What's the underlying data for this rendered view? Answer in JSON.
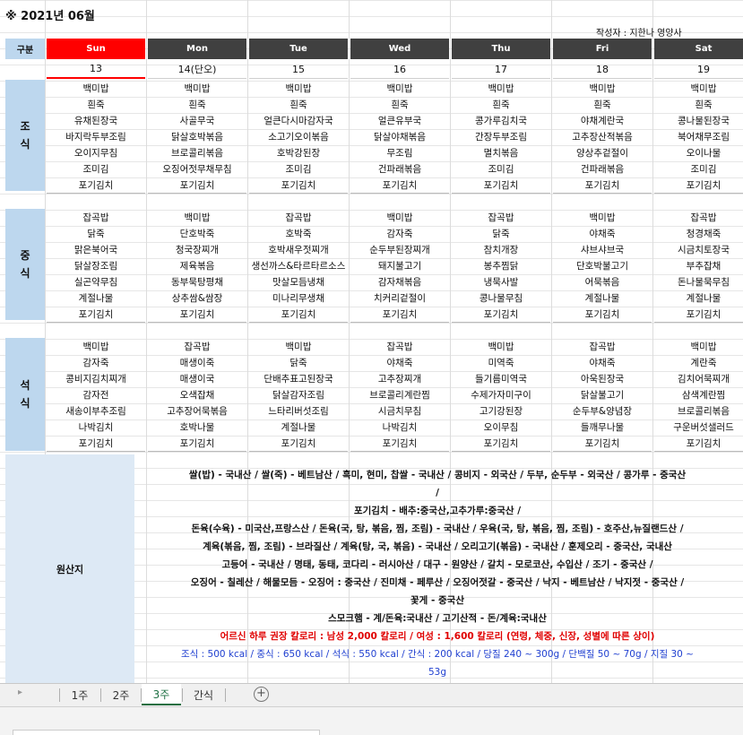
{
  "title": "※ 2021년 06월",
  "author": "작성자 : 지한나 영양사",
  "header": {
    "gubun": "구분",
    "days": [
      "Sun",
      "Mon",
      "Tue",
      "Wed",
      "Thu",
      "Fri",
      "Sat"
    ],
    "dates": [
      "13",
      "14(단오)",
      "15",
      "16",
      "17",
      "18",
      "19"
    ]
  },
  "sections": {
    "breakfast": "조식",
    "lunch": "중식",
    "dinner": "석식",
    "origin": "원산지"
  },
  "menus": {
    "breakfast": [
      [
        "백미밥",
        "흰죽",
        "유채된장국",
        "바지락두부조림",
        "오이지무침",
        "조미김",
        "포기김치"
      ],
      [
        "백미밥",
        "흰죽",
        "사골무국",
        "닭살호박볶음",
        "브로콜리볶음",
        "오징어젓무채무침",
        "포기김치"
      ],
      [
        "백미밥",
        "흰죽",
        "얼큰다시마감자국",
        "소고기오이볶음",
        "호박강된장",
        "조미김",
        "포기김치"
      ],
      [
        "백미밥",
        "흰죽",
        "얼큰유부국",
        "닭살야채볶음",
        "무조림",
        "건파래볶음",
        "포기김치"
      ],
      [
        "백미밥",
        "흰죽",
        "콩가루김치국",
        "간장두부조림",
        "멸치볶음",
        "조미김",
        "포기김치"
      ],
      [
        "백미밥",
        "흰죽",
        "야채계란국",
        "고추장산적볶음",
        "양상추겉절이",
        "건파래볶음",
        "포기김치"
      ],
      [
        "백미밥",
        "흰죽",
        "콩나물된장국",
        "북어채무조림",
        "오이나물",
        "조미김",
        "포기김치"
      ]
    ],
    "lunch": [
      [
        "잡곡밥",
        "닭죽",
        "맑은북어국",
        "닭살장조림",
        "실곤약무침",
        "계절나물",
        "포기김치"
      ],
      [
        "백미밥",
        "단호박죽",
        "청국장찌개",
        "제육볶음",
        "동부묵탕평채",
        "상추쌈&쌈장",
        "포기김치"
      ],
      [
        "잡곡밥",
        "호박죽",
        "호박새우젓찌개",
        "생선까스&타르타르소스",
        "맛살모듬냉채",
        "미나리무생채",
        "포기김치"
      ],
      [
        "백미밥",
        "감자죽",
        "순두부된장찌개",
        "돼지불고기",
        "감자채볶음",
        "치커리겉절이",
        "포기김치"
      ],
      [
        "잡곡밥",
        "닭죽",
        "참치개장",
        "봉추찜닭",
        "냉묵사발",
        "콩나물무침",
        "포기김치"
      ],
      [
        "백미밥",
        "야채죽",
        "샤브샤브국",
        "단호박불고기",
        "어묵볶음",
        "계절나물",
        "포기김치"
      ],
      [
        "잡곡밥",
        "청경채죽",
        "시금치토장국",
        "부추잡채",
        "돈나물묵무침",
        "계절나물",
        "포기김치"
      ]
    ],
    "dinner": [
      [
        "백미밥",
        "감자죽",
        "콩비지김치찌개",
        "감자전",
        "새송이부추조림",
        "나박김치",
        "포기김치"
      ],
      [
        "잡곡밥",
        "매생이죽",
        "매생이국",
        "오색잡채",
        "고추장어묵볶음",
        "호박나물",
        "포기김치"
      ],
      [
        "백미밥",
        "닭죽",
        "단배추표고된장국",
        "닭살감자조림",
        "느타리버섯조림",
        "계절나물",
        "포기김치"
      ],
      [
        "잡곡밥",
        "야채죽",
        "고추장찌개",
        "브로콜리계란찜",
        "시금치무침",
        "나박김치",
        "포기김치"
      ],
      [
        "백미밥",
        "미역죽",
        "들기름미역국",
        "수제가자미구이",
        "고기강된장",
        "오이무침",
        "포기김치"
      ],
      [
        "잡곡밥",
        "야채죽",
        "아욱된장국",
        "닭살불고기",
        "순두부&양념장",
        "들깨무나물",
        "포기김치"
      ],
      [
        "백미밥",
        "계란죽",
        "김치어묵찌개",
        "삼색계란찜",
        "브로콜리볶음",
        "구운버섯샐러드",
        "포기김치"
      ]
    ]
  },
  "origin_lines": [
    "쌀(밥) - 국내산 / 쌀(죽) - 베트남산 / 흑미, 현미, 찹쌀 - 국내산 / 콩비지 - 외국산 / 두부, 순두부 - 외국산 / 콩가루 - 중국산",
    "/",
    "포기김치 - 배추:중국산,고추가루:중국산 /",
    "돈육(수육) - 미국산,프랑스산 / 돈육(국, 탕, 볶음, 찜, 조림) - 국내산 / 우육(국, 탕, 볶음, 찜, 조림) - 호주산,뉴질랜드산 /",
    "계육(볶음, 찜, 조림) - 브라질산 / 계육(탕, 국, 볶음) - 국내산 / 오리고기(볶음) - 국내산 / 훈제오리 - 중국산, 국내산",
    "고등어 - 국내산 / 명태, 동태, 코다리 - 러시아산 / 대구 - 원양산 / 갈치 - 모로코산, 수입산 / 조기 - 중국산 /",
    "오징어 - 칠레산 / 해물모듬 - 오징어 : 중국산 / 진미채 - 페루산 / 오징어젓갈 - 중국산 / 낙지 - 베트남산 / 낙지젓 - 중국산 /",
    "꽃게 - 중국산",
    "스모크햄 - 계/돈육:국내산 / 고기산적 - 돈/계육:국내산"
  ],
  "kcal_note": "어르신 하루 권장 칼로리 : 남성 2,000 칼로리 / 여성 : 1,600 칼로리 (연령, 체중, 신장, 성별에 따른 상이)",
  "kcal_meals_1": "조식 : 500 kcal / 중식 : 650 kcal / 석식 : 550 kcal / 간식 : 200 kcal / 당질 240 ~ 300g / 단백질 50 ~ 70g / 지질 30 ~",
  "kcal_meals_2": "53g",
  "tabs": [
    "1주",
    "2주",
    "3주",
    "간식"
  ],
  "active_tab": "3주",
  "colors": {
    "sunday": "#ff0000",
    "weekday": "#404040",
    "section_bg": "#bdd7ee",
    "kcal_red": "#e00000",
    "kcal_blue": "#1f3fd0",
    "active_tab": "#1d6f42"
  }
}
